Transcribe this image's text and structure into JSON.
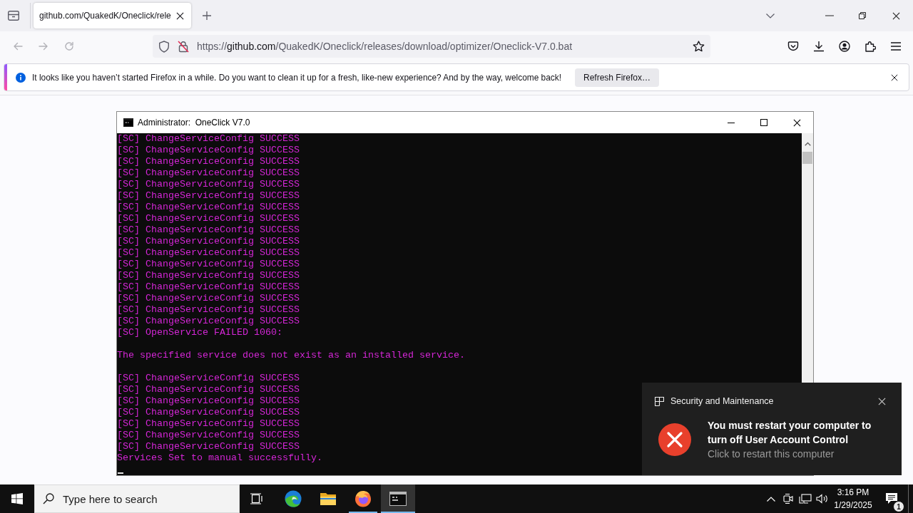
{
  "browser": {
    "tabs": [
      {
        "title": "github.com/QuakedK/Oneclick/rele",
        "selected": true
      }
    ],
    "navigation": [
      {
        "kind": "back",
        "disabled": true
      },
      {
        "kind": "forward",
        "disabled": true
      },
      {
        "kind": "reload",
        "disabled": true
      }
    ],
    "address": {
      "scheme": "https://",
      "host": "github.com",
      "path": "/QuakedK/Oneclick/releases/download/optimizer/Oneclick-V7.0.bat"
    },
    "notification": {
      "message": "It looks like you haven’t started Firefox in a while. Do you want to clean it up for a fresh, like-new experience? And by the way, welcome back!",
      "button": "Refresh Firefox…"
    }
  },
  "console_window": {
    "title": "Administrator:  OneClick V7.0",
    "output": [
      {
        "lines": [
          "[SC] ChangeServiceConfig SUCCESS",
          "[SC] ChangeServiceConfig SUCCESS",
          "[SC] ChangeServiceConfig SUCCESS",
          "[SC] ChangeServiceConfig SUCCESS",
          "[SC] ChangeServiceConfig SUCCESS",
          "[SC] ChangeServiceConfig SUCCESS",
          "[SC] ChangeServiceConfig SUCCESS",
          "[SC] ChangeServiceConfig SUCCESS",
          "[SC] ChangeServiceConfig SUCCESS",
          "[SC] ChangeServiceConfig SUCCESS",
          "[SC] ChangeServiceConfig SUCCESS",
          "[SC] ChangeServiceConfig SUCCESS",
          "[SC] ChangeServiceConfig SUCCESS",
          "[SC] ChangeServiceConfig SUCCESS",
          "[SC] ChangeServiceConfig SUCCESS",
          "[SC] ChangeServiceConfig SUCCESS",
          "[SC] ChangeServiceConfig SUCCESS",
          "[SC] OpenService FAILED 1060:"
        ]
      },
      {
        "lines": [
          "The specified service does not exist as an installed service."
        ]
      },
      {
        "lines": [
          "[SC] ChangeServiceConfig SUCCESS",
          "[SC] ChangeServiceConfig SUCCESS",
          "[SC] ChangeServiceConfig SUCCESS",
          "[SC] ChangeServiceConfig SUCCESS",
          "[SC] ChangeServiceConfig SUCCESS",
          "[SC] ChangeServiceConfig SUCCESS",
          "[SC] ChangeServiceConfig SUCCESS",
          "Services Set to manual successfully."
        ]
      }
    ]
  },
  "toast": {
    "source": "Security and Maintenance",
    "title": "You must restart your computer to turn off User Account Control",
    "body": "Click to restart this computer"
  },
  "taskbar": {
    "search": {
      "placeholder": "Type here to search"
    },
    "apps": [
      {
        "kind": "edge",
        "running": false,
        "selected": false
      },
      {
        "kind": "explorer",
        "running": false,
        "selected": false
      },
      {
        "kind": "firefox",
        "running": true,
        "selected": false
      },
      {
        "kind": "terminal",
        "running": true,
        "selected": true
      }
    ],
    "clock": {
      "time": "3:16 PM",
      "date": "1/29/2025"
    },
    "notifications": {
      "count": "1"
    }
  }
}
